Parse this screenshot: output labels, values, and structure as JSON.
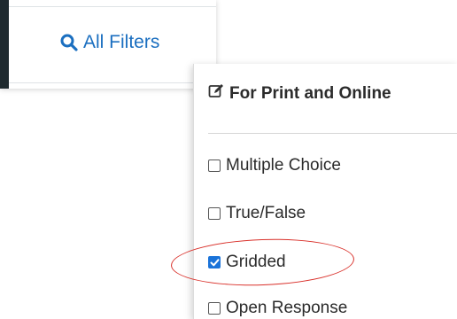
{
  "toolbar": {
    "all_filters_label": "All Filters",
    "search_icon": "search-icon"
  },
  "panel": {
    "header_label": "For Print and Online",
    "header_icon": "edit-icon",
    "options": [
      {
        "label": "Multiple Choice",
        "checked": false
      },
      {
        "label": "True/False",
        "checked": false
      },
      {
        "label": "Gridded",
        "checked": true
      },
      {
        "label": "Open Response",
        "checked": false
      }
    ]
  },
  "colors": {
    "accent": "#1b6fc0",
    "checkbox_checked": "#1a73d9",
    "annotation_red": "#d9302a"
  }
}
